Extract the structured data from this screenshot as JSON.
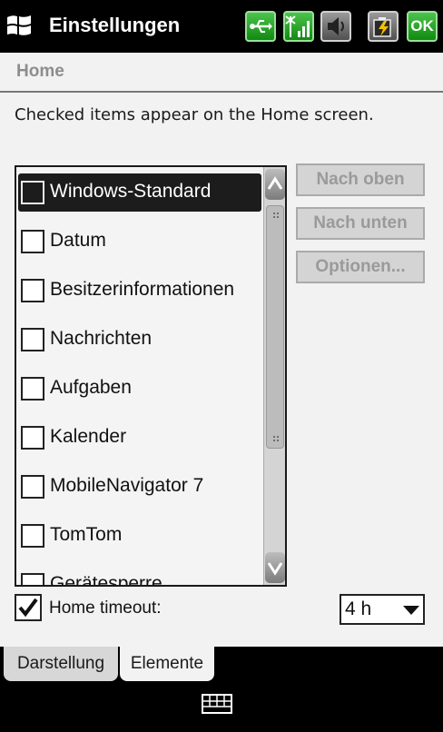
{
  "titlebar": {
    "title": "Einstellungen",
    "icons": [
      "usb-connection-icon",
      "signal-strength-icon",
      "speaker-icon",
      "battery-charging-icon"
    ],
    "ok_label": "OK"
  },
  "header": {
    "title": "Home"
  },
  "description": "Checked items appear on the Home screen.",
  "list": {
    "items": [
      {
        "label": "Windows-Standard",
        "checked": false,
        "selected": true
      },
      {
        "label": "Datum",
        "checked": false,
        "selected": false
      },
      {
        "label": "Besitzerinformationen",
        "checked": false,
        "selected": false
      },
      {
        "label": "Nachrichten",
        "checked": false,
        "selected": false
      },
      {
        "label": "Aufgaben",
        "checked": false,
        "selected": false
      },
      {
        "label": "Kalender",
        "checked": false,
        "selected": false
      },
      {
        "label": "MobileNavigator 7",
        "checked": false,
        "selected": false
      },
      {
        "label": "TomTom",
        "checked": false,
        "selected": false
      },
      {
        "label": "Gerätesperre",
        "checked": false,
        "selected": false
      }
    ]
  },
  "buttons": {
    "up": "Nach oben",
    "down": "Nach unten",
    "options": "Optionen..."
  },
  "home_timeout": {
    "label": "Home timeout:",
    "checked": true,
    "value": "4 h"
  },
  "tabs": [
    {
      "label": "Darstellung",
      "active": false
    },
    {
      "label": "Elemente",
      "active": true
    }
  ],
  "colors": {
    "titlebar_bg": "#000000",
    "status_icon_green": "#1e9e1e",
    "selection_bg": "#1c1c1c"
  }
}
